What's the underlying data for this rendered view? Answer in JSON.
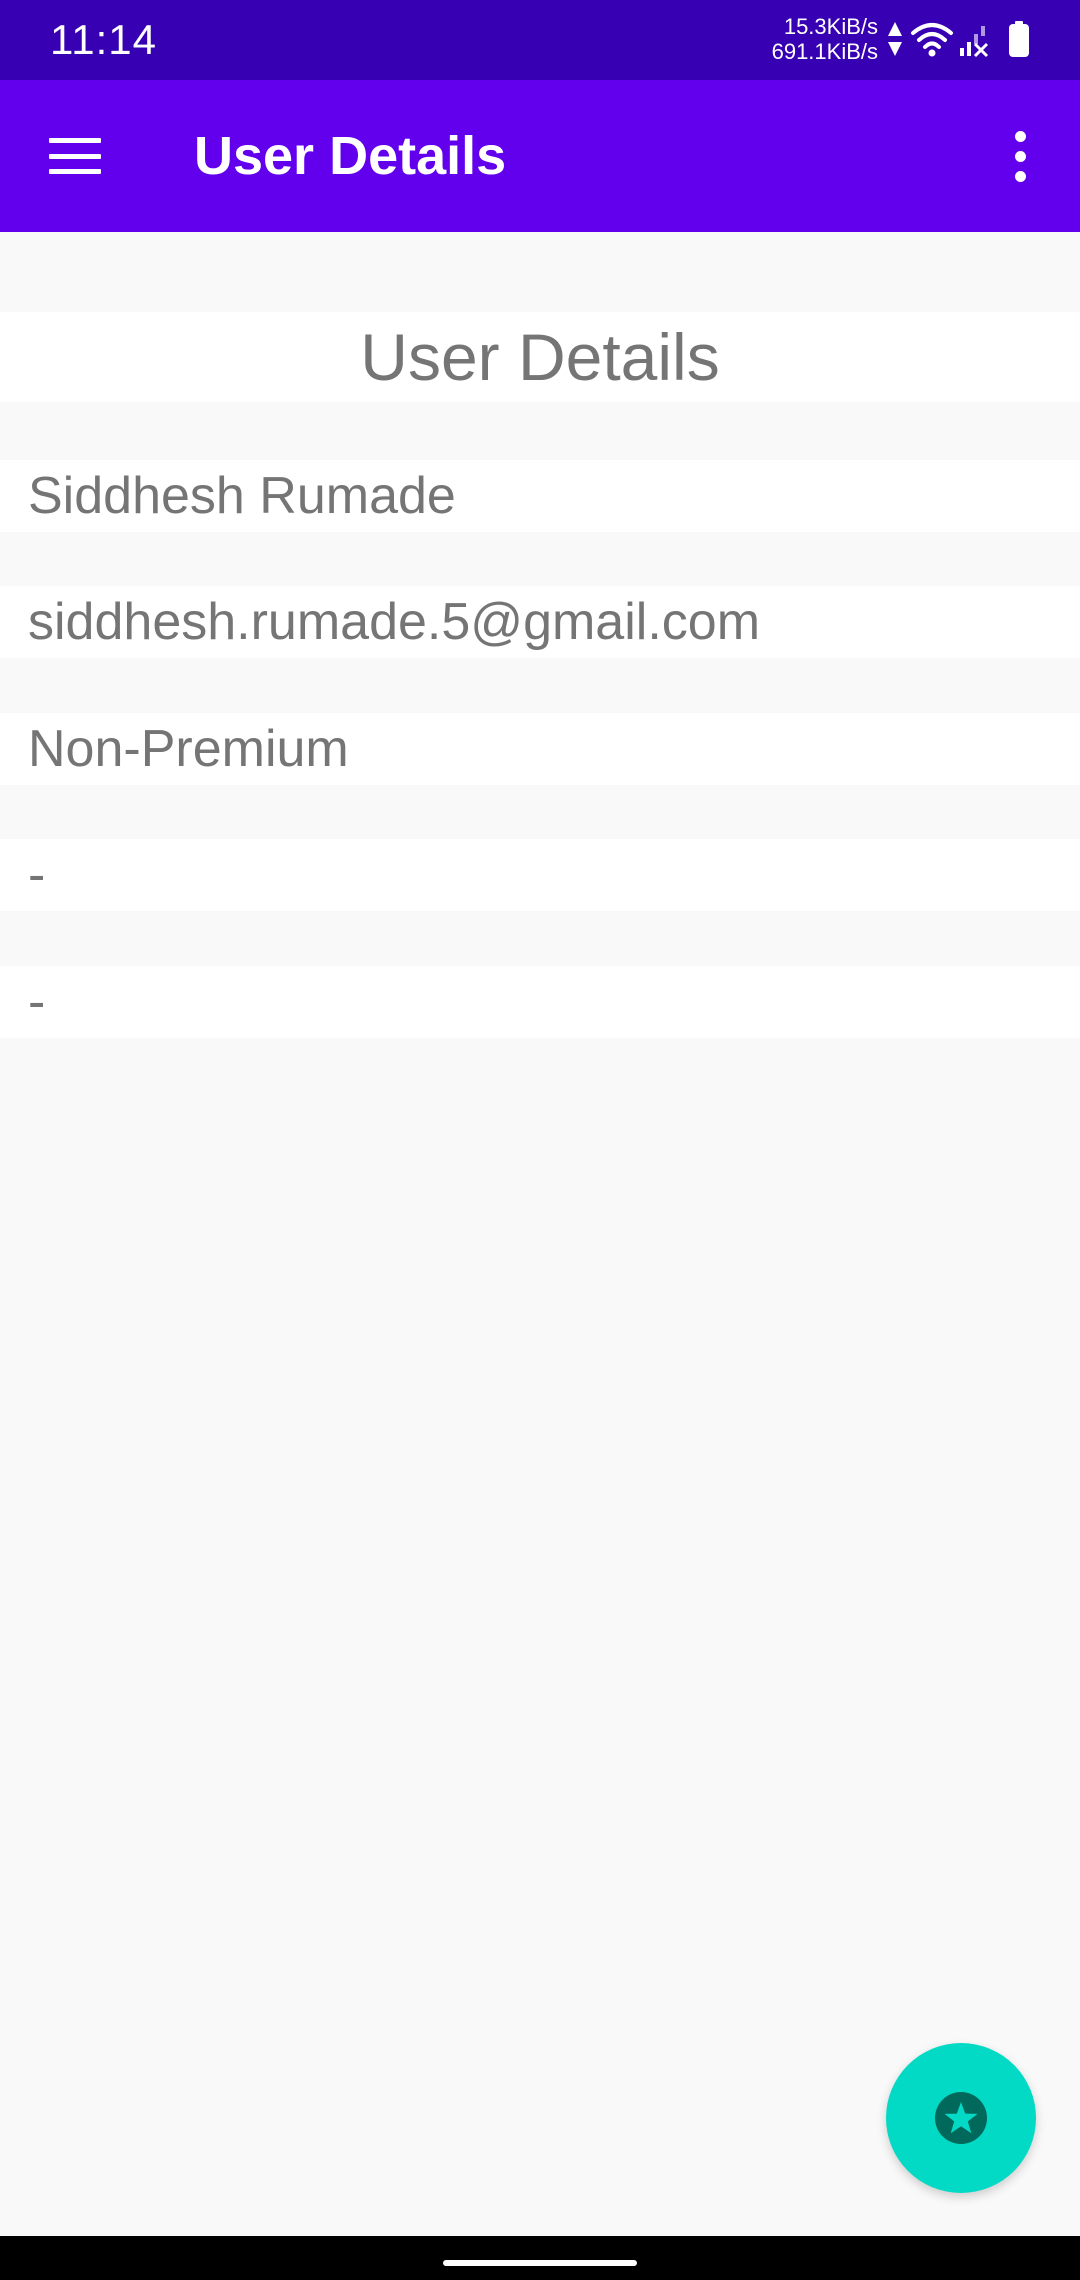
{
  "status_bar": {
    "time": "11:14",
    "upload_speed": "15.3KiB/s",
    "download_speed": "691.1KiB/s",
    "icons": [
      "data-arrows-icon",
      "wifi-icon",
      "signal-no-service-icon",
      "battery-icon"
    ]
  },
  "app_bar": {
    "title": "User Details",
    "left_icon": "hamburger-menu-icon",
    "right_icon": "overflow-menu-icon",
    "color": "#6200ee"
  },
  "content": {
    "heading": "User Details",
    "name": "Siddhesh Rumade",
    "email": "siddhesh.rumade.5@gmail.com",
    "membership": "Non-Premium",
    "field_4": "-",
    "field_5": "-"
  },
  "fab": {
    "icon": "star-badge-icon",
    "color": "#03dac5"
  },
  "colors": {
    "status_bar": "#3700b3",
    "background": "#f9f9f9",
    "text": "#757575"
  }
}
